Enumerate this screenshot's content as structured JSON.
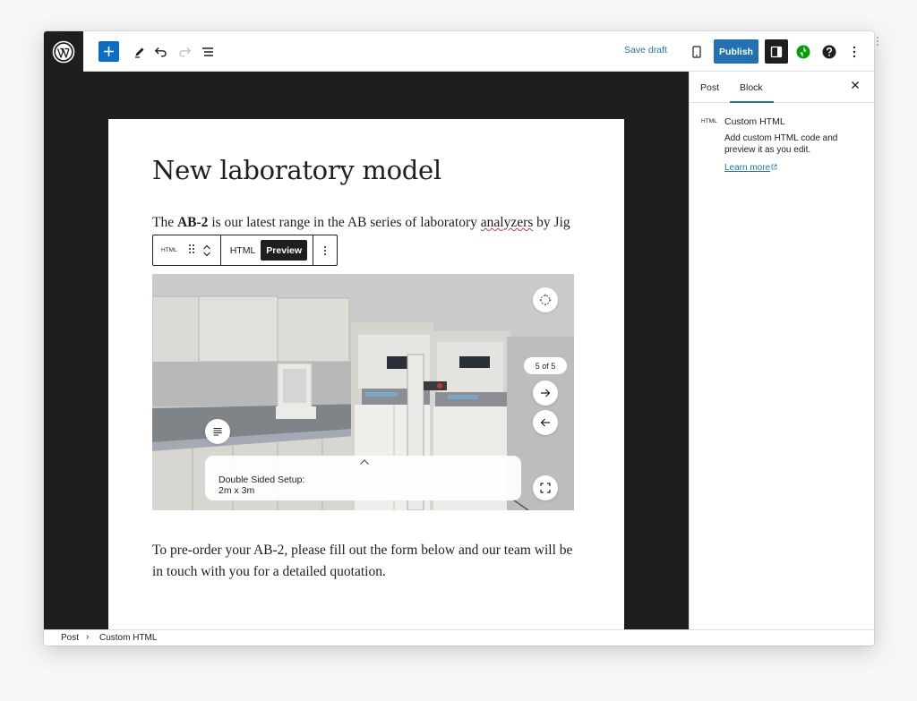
{
  "toolbar": {
    "save_draft_label": "Save draft",
    "publish_label": "Publish"
  },
  "post": {
    "title": "New laboratory model",
    "intro_pre": "The ",
    "intro_bold": "AB-2",
    "intro_mid": " is our latest range in the AB series of laboratory ",
    "intro_misspelled": "analyzers",
    "intro_post": " by Jig",
    "closing": "To pre-order your AB-2, please fill out the form below and our team will be in touch with you for a detailed quotation."
  },
  "block_toolbar": {
    "type_label": "HTML",
    "tab_html": "HTML",
    "tab_preview": "Preview",
    "active_tab": "Preview"
  },
  "viewer": {
    "counter": "5 of 5",
    "caption_line1": "Double Sided Setup:",
    "caption_line2": "2m x 3m"
  },
  "sidebar": {
    "tab_post": "Post",
    "tab_block": "Block",
    "active_tab": "Block",
    "block_icon_label": "HTML",
    "block_title": "Custom HTML",
    "block_description": "Add custom HTML code and preview it as you edit.",
    "learn_more": "Learn more"
  },
  "footer": {
    "breadcrumb": [
      "Post",
      "Custom HTML"
    ]
  },
  "colors": {
    "accent": "#2271b1",
    "dark": "#1e1e1e",
    "jetpack_green": "#069e08"
  }
}
